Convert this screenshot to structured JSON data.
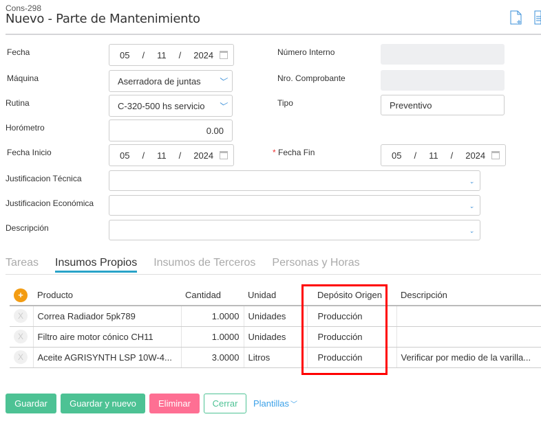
{
  "header": {
    "code": "Cons-298",
    "title": "Nuevo - Parte de Mantenimiento"
  },
  "form": {
    "fecha": {
      "label": "Fecha",
      "day": "05",
      "month": "11",
      "year": "2024"
    },
    "maquina": {
      "label": "Máquina",
      "value": "Aserradora de juntas"
    },
    "rutina": {
      "label": "Rutina",
      "value": "C-320-500 hs servicio"
    },
    "horometro": {
      "label": "Horómetro",
      "value": "0.00"
    },
    "fecha_inicio": {
      "label": "Fecha Inicio",
      "day": "05",
      "month": "11",
      "year": "2024"
    },
    "numero_interno": {
      "label": "Número Interno",
      "value": ""
    },
    "nro_comprobante": {
      "label": "Nro. Comprobante",
      "value": ""
    },
    "tipo": {
      "label": "Tipo",
      "value": "Preventivo"
    },
    "fecha_fin": {
      "label": "Fecha Fin",
      "required": "*",
      "day": "05",
      "month": "11",
      "year": "2024"
    },
    "just_tecnica": {
      "label": "Justificacion Técnica"
    },
    "just_economica": {
      "label": "Justificacion Económica"
    },
    "descripcion": {
      "label": "Descripción"
    },
    "sep": "/"
  },
  "tabs": [
    "Tareas",
    "Insumos Propios",
    "Insumos de Terceros",
    "Personas y Horas"
  ],
  "table": {
    "headers": [
      "Producto",
      "Cantidad",
      "Unidad",
      "Depósito Origen",
      "Descripción"
    ],
    "rows": [
      [
        "Correa Radiador 5pk789",
        "1.0000",
        "Unidades",
        "Producción",
        ""
      ],
      [
        "Filtro aire motor cónico CH11",
        "1.0000",
        "Unidades",
        "Producción",
        ""
      ],
      [
        "Aceite AGRISYNTH LSP 10W-4...",
        "3.0000",
        "Litros",
        "Producción",
        "Verificar por medio de la varilla..."
      ]
    ],
    "remove": "X",
    "add": "+"
  },
  "buttons": {
    "guardar": "Guardar",
    "guardar_nuevo": "Guardar y nuevo",
    "eliminar": "Eliminar",
    "cerrar": "Cerrar",
    "plantillas": "Plantillas"
  }
}
